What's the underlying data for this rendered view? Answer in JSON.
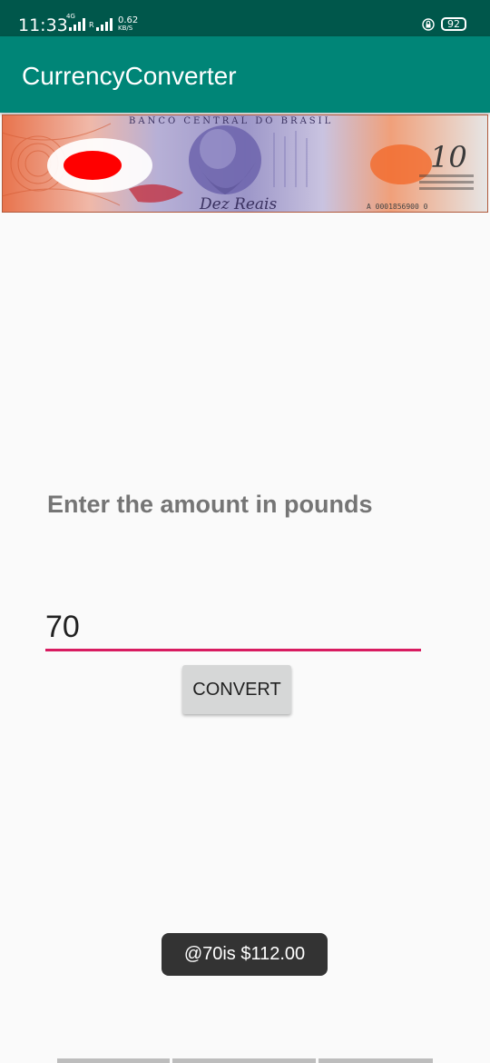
{
  "status_bar": {
    "time": "11:33",
    "network": "4G",
    "roaming": "R",
    "speed_value": "0.62",
    "speed_unit": "KB/S",
    "battery": "92",
    "icons": [
      "signal-icon",
      "lock-icon",
      "battery-icon"
    ]
  },
  "app_bar": {
    "title": "CurrencyConverter",
    "color": "#008577"
  },
  "banner": {
    "issuer_text": "BANCO CENTRAL DO BRASIL",
    "denomination_text": "Dez Reais",
    "value_text": "10",
    "serial_text": "A 0001856900 0"
  },
  "main": {
    "instruction": "Enter the amount in pounds",
    "amount_value": "70",
    "convert_label": "CONVERT"
  },
  "toast": {
    "message": "@70is $112.00"
  },
  "colors": {
    "accent": "#d81b60",
    "primary_dark": "#00574b",
    "background": "#fafafa"
  }
}
